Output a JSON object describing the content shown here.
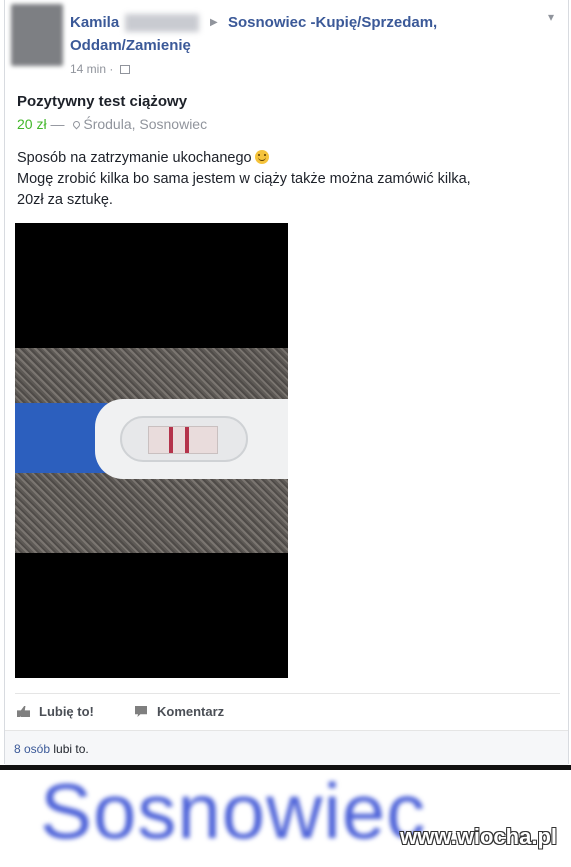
{
  "post": {
    "author_name": "Kamila",
    "group_name_line1": "Sosnowiec -Kupię/Sprzedam,",
    "group_name_line2": "Oddam/Zamienię",
    "time": "14 min ·",
    "title": "Pozytywny test ciążowy",
    "price": "20 zł",
    "dash": " —",
    "location": "Środula, Sosnowiec",
    "body_line1": "Sposób na zatrzymanie ukochanego",
    "body_line2": "Mogę zrobić kilka bo sama jestem w ciąży także można zamówić kilka,",
    "body_line3": "20zł za sztukę."
  },
  "actions": {
    "like_label": "Lubię to!",
    "comment_label": "Komentarz"
  },
  "likes": {
    "count": "8 osób",
    "suffix": " lubi to."
  },
  "banner": {
    "city": "Sosnowiec",
    "watermark": "www.wiocha.pl"
  },
  "icons": [
    "group-arrow-icon",
    "group-privacy-icon",
    "chevron-down-icon",
    "location-pin-icon",
    "smiley-emoji-icon",
    "like-thumb-icon",
    "comment-bubble-icon"
  ],
  "colors": {
    "link_blue": "#3b5998",
    "price_green": "#42b72a",
    "meta_gray": "#90949c",
    "test_line_red": "#b4334b",
    "test_blue": "#2c5fbe"
  }
}
